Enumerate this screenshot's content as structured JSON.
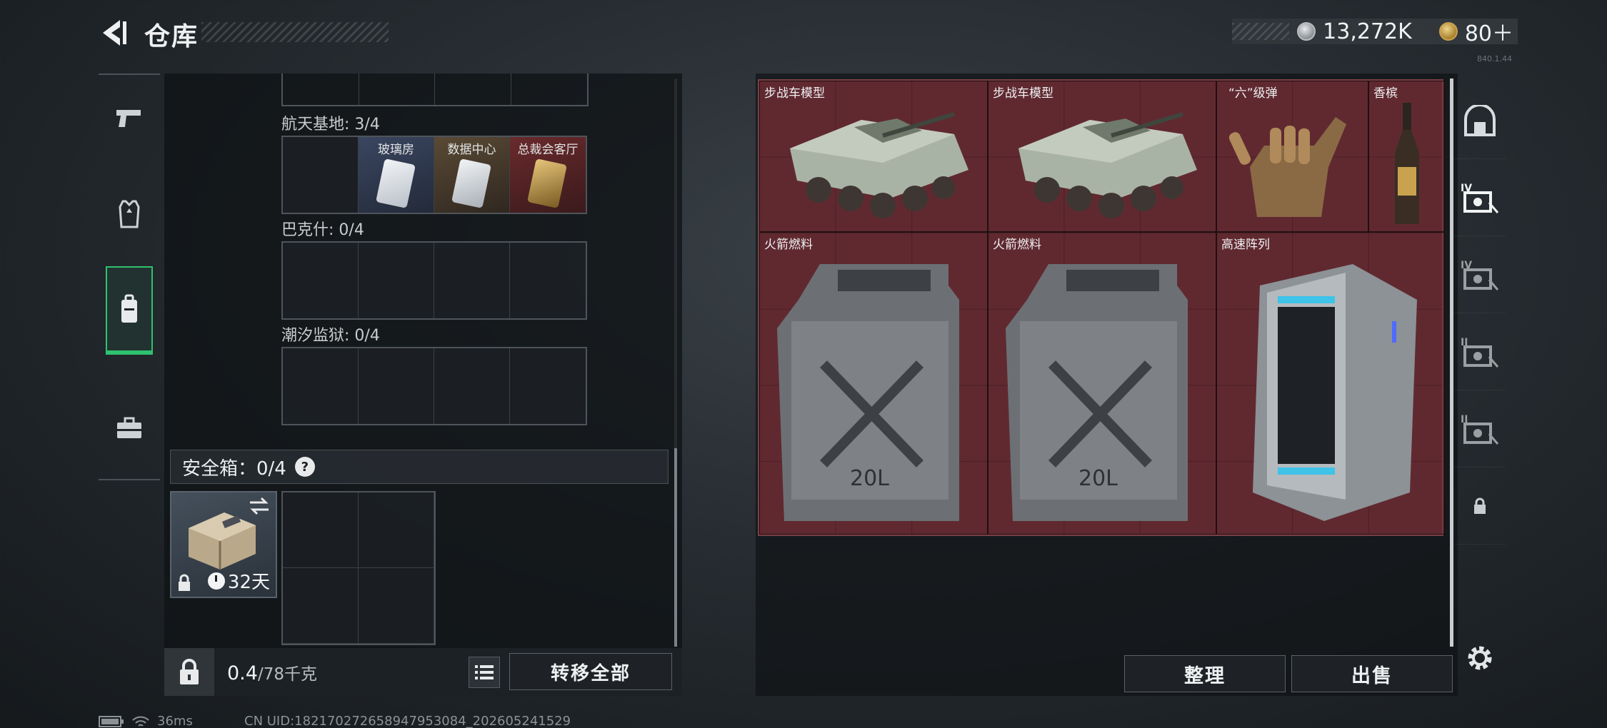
{
  "header": {
    "title": "仓库",
    "currency_silver": "13,272K",
    "currency_gold": "80＋",
    "version": "840.1.44"
  },
  "rail": {
    "tabs": [
      {
        "icon": "pistol-icon"
      },
      {
        "icon": "vest-icon"
      },
      {
        "icon": "backpack-icon",
        "active": true
      },
      {
        "icon": "briefcase-icon"
      }
    ]
  },
  "keycards": {
    "groups": [
      {
        "label": "航天基地: 3/4",
        "slots": [
          "玻璃房",
          "数据中心",
          "总裁会客厅",
          ""
        ]
      },
      {
        "label": "巴克什: 0/4"
      },
      {
        "label": "潮汐监狱: 0/4"
      }
    ]
  },
  "safe_box": {
    "label": "安全箱：0/4",
    "help": "?",
    "days": "32天"
  },
  "bottom_bar": {
    "weight_current": "0.4",
    "weight_max": "/78千克",
    "transfer_label": "转移全部"
  },
  "stash": {
    "items": [
      {
        "name": "步战车模型"
      },
      {
        "name": "步战车模型"
      },
      {
        "name": "“六”级弹"
      },
      {
        "name": "香槟"
      },
      {
        "name": "火箭燃料"
      },
      {
        "name": "火箭燃料"
      },
      {
        "name": "高速阵列"
      }
    ]
  },
  "actions": {
    "sort_label": "整理",
    "sell_label": "出售"
  },
  "status_bar": {
    "ping": "36ms",
    "uid": "CN UID:18217027265894795308​4_202605241529"
  },
  "colors": {
    "accent_green": "#2fc16f",
    "stash_red": "#5a2a30"
  }
}
